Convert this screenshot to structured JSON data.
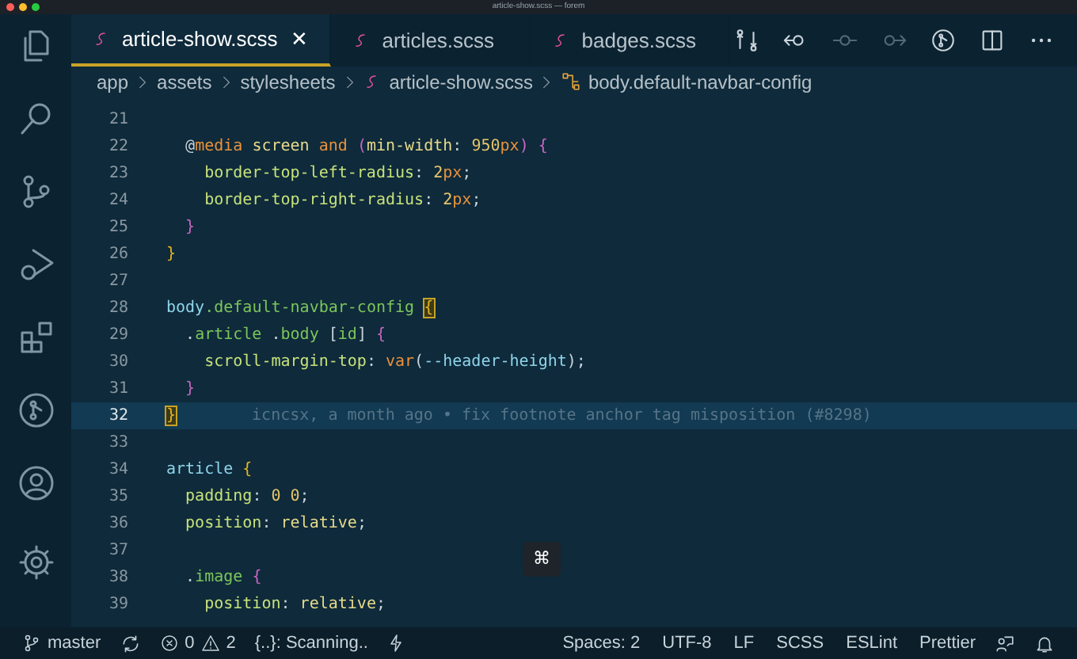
{
  "window": {
    "title": "article-show.scss — forem"
  },
  "tabs": [
    {
      "label": "article-show.scss",
      "selected": true,
      "close": "✕"
    },
    {
      "label": "articles.scss",
      "selected": false
    },
    {
      "label": "badges.scss",
      "selected": false
    }
  ],
  "breadcrumb": [
    {
      "label": "app",
      "kind": "folder"
    },
    {
      "label": "assets",
      "kind": "folder"
    },
    {
      "label": "stylesheets",
      "kind": "folder"
    },
    {
      "label": "article-show.scss",
      "kind": "file"
    },
    {
      "label": "body.default-navbar-config",
      "kind": "symbol"
    }
  ],
  "editor": {
    "lines": [
      {
        "number": "21",
        "current": false
      },
      {
        "number": "22",
        "current": false,
        "tokens": [
          {
            "text": "  @",
            "kind": "punct"
          },
          {
            "text": "media ",
            "kind": "at"
          },
          {
            "text": "screen ",
            "kind": "value"
          },
          {
            "text": "and ",
            "kind": "at"
          },
          {
            "text": "(",
            "kind": "brace2"
          },
          {
            "text": "min-width",
            "kind": "value"
          },
          {
            "text": ": ",
            "kind": "punct"
          },
          {
            "text": "950",
            "kind": "num"
          },
          {
            "text": "px",
            "kind": "unit"
          },
          {
            "text": ") ",
            "kind": "brace2"
          },
          {
            "text": "{",
            "kind": "brace2"
          }
        ]
      },
      {
        "number": "23",
        "current": false,
        "tokens": [
          {
            "text": "    border-top-left-radius",
            "kind": "prop"
          },
          {
            "text": ": ",
            "kind": "punct"
          },
          {
            "text": "2",
            "kind": "num"
          },
          {
            "text": "px",
            "kind": "unit"
          },
          {
            "text": ";",
            "kind": "punct"
          }
        ]
      },
      {
        "number": "24",
        "current": false,
        "tokens": [
          {
            "text": "    border-top-right-radius",
            "kind": "prop"
          },
          {
            "text": ": ",
            "kind": "punct"
          },
          {
            "text": "2",
            "kind": "num"
          },
          {
            "text": "px",
            "kind": "unit"
          },
          {
            "text": ";",
            "kind": "punct"
          }
        ]
      },
      {
        "number": "25",
        "current": false,
        "tokens": [
          {
            "text": "  }",
            "kind": "brace2"
          }
        ]
      },
      {
        "number": "26",
        "current": false,
        "tokens": [
          {
            "text": "}",
            "kind": "brace1"
          }
        ]
      },
      {
        "number": "27",
        "current": false
      },
      {
        "number": "28",
        "current": false,
        "tokens": [
          {
            "text": "body",
            "kind": "tag"
          },
          {
            "text": ".default-navbar-config ",
            "kind": "class"
          },
          {
            "text": "{",
            "kind": "brace1",
            "match": true
          }
        ]
      },
      {
        "number": "29",
        "current": false,
        "tokens": [
          {
            "text": "  .",
            "kind": "punct"
          },
          {
            "text": "article ",
            "kind": "class"
          },
          {
            "text": ".",
            "kind": "punct"
          },
          {
            "text": "body ",
            "kind": "class"
          },
          {
            "text": "[",
            "kind": "punct"
          },
          {
            "text": "id",
            "kind": "class"
          },
          {
            "text": "] ",
            "kind": "punct"
          },
          {
            "text": "{",
            "kind": "brace2"
          }
        ]
      },
      {
        "number": "30",
        "current": false,
        "tokens": [
          {
            "text": "    scroll-margin-top",
            "kind": "prop"
          },
          {
            "text": ": ",
            "kind": "punct"
          },
          {
            "text": "var",
            "kind": "unit"
          },
          {
            "text": "(",
            "kind": "punct"
          },
          {
            "text": "--header-height",
            "kind": "tag"
          },
          {
            "text": ");",
            "kind": "punct"
          }
        ]
      },
      {
        "number": "31",
        "current": false,
        "tokens": [
          {
            "text": "  }",
            "kind": "brace2"
          }
        ]
      },
      {
        "number": "32",
        "current": true,
        "tokens": [
          {
            "text": "}",
            "kind": "brace1",
            "match": true
          }
        ],
        "blame": "icncsx, a month ago • fix footnote anchor tag misposition (#8298)"
      },
      {
        "number": "33",
        "current": false
      },
      {
        "number": "34",
        "current": false,
        "tokens": [
          {
            "text": "article ",
            "kind": "tag"
          },
          {
            "text": "{",
            "kind": "brace1"
          }
        ]
      },
      {
        "number": "35",
        "current": false,
        "tokens": [
          {
            "text": "  padding",
            "kind": "prop"
          },
          {
            "text": ": ",
            "kind": "punct"
          },
          {
            "text": "0 0",
            "kind": "num"
          },
          {
            "text": ";",
            "kind": "punct"
          }
        ]
      },
      {
        "number": "36",
        "current": false,
        "tokens": [
          {
            "text": "  position",
            "kind": "prop"
          },
          {
            "text": ": ",
            "kind": "punct"
          },
          {
            "text": "relative",
            "kind": "value"
          },
          {
            "text": ";",
            "kind": "punct"
          }
        ]
      },
      {
        "number": "37",
        "current": false
      },
      {
        "number": "38",
        "current": false,
        "tokens": [
          {
            "text": "  .",
            "kind": "punct"
          },
          {
            "text": "image ",
            "kind": "class"
          },
          {
            "text": "{",
            "kind": "brace2"
          }
        ]
      },
      {
        "number": "39",
        "current": false,
        "tokens": [
          {
            "text": "    position",
            "kind": "prop"
          },
          {
            "text": ": ",
            "kind": "punct"
          },
          {
            "text": "relative",
            "kind": "value"
          },
          {
            "text": ";",
            "kind": "punct"
          }
        ]
      }
    ]
  },
  "key_popup": {
    "label": "⌘"
  },
  "status_bar": {
    "branch": "master",
    "errors": "0",
    "warnings": "2",
    "scanning": "{..}: Scanning..",
    "right": [
      "Spaces: 2",
      "UTF-8",
      "LF",
      "SCSS",
      "ESLint",
      "Prettier"
    ]
  }
}
